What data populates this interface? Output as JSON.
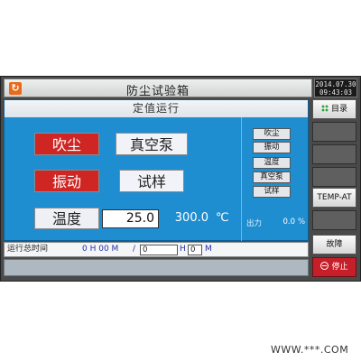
{
  "header": {
    "title": "防尘试验箱",
    "home_icon": "refresh-home-icon",
    "date": "2014.07.30",
    "time": "09:43:03"
  },
  "panel": {
    "title": "定值运行",
    "modes": [
      {
        "label": "吹尘",
        "active": true
      },
      {
        "label": "真空泵",
        "active": false
      },
      {
        "label": "振动",
        "active": true
      },
      {
        "label": "试样",
        "active": false
      }
    ],
    "temperature": {
      "label": "温度",
      "setpoint": "25.0",
      "value": "300.0",
      "unit": "℃"
    },
    "status_items": [
      "吹尘",
      "振动",
      "温度",
      "真空泵",
      "试样"
    ],
    "output": {
      "label": "出力",
      "value": "0.0",
      "unit": "%"
    }
  },
  "runtime": {
    "label": "运行总时间",
    "total": "0 H 00 M",
    "slash": "/",
    "hours_value": "0",
    "hours_unit": "H",
    "minutes_value": "0",
    "minutes_unit": "M"
  },
  "sidebar": {
    "menu_label": "目录",
    "mode_label": "TEMP-AT",
    "fault_label": "故障",
    "stop_label": "停止"
  },
  "colors": {
    "panel_bg": "#1f8ed1",
    "active_mode": "#cf2624",
    "stop_button": "#c61f2a"
  },
  "watermark": "WWW.***.COM"
}
